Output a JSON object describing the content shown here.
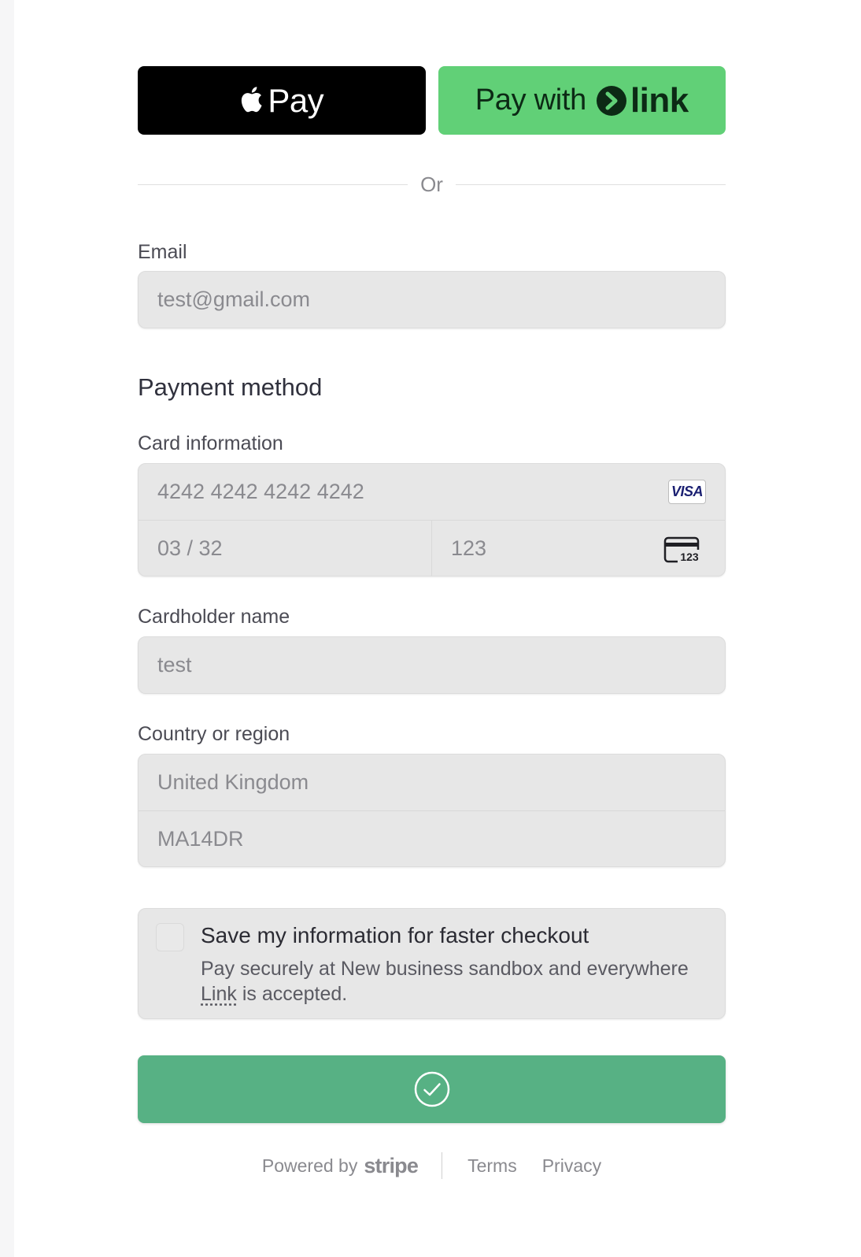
{
  "express": {
    "apple_pay_label": "Pay",
    "link_pay_prefix": "Pay with",
    "link_brand": "link"
  },
  "divider": {
    "text": "Or"
  },
  "email": {
    "label": "Email",
    "value": "test@gmail.com"
  },
  "payment_method": {
    "title": "Payment method",
    "card_info_label": "Card information",
    "card_number": "4242 4242 4242 4242",
    "card_brand": "VISA",
    "expiry": "03 / 32",
    "cvc": "123",
    "cvc_icon_text": "123"
  },
  "cardholder": {
    "label": "Cardholder name",
    "value": "test"
  },
  "country": {
    "label": "Country or region",
    "value": "United Kingdom",
    "postal_code": "MA14DR"
  },
  "save_info": {
    "checked": false,
    "title": "Save my information for faster checkout",
    "desc_before": "Pay securely at New business sandbox and everywhere",
    "desc_link": "Link",
    "desc_after": "is accepted."
  },
  "submit": {
    "state": "success",
    "icon": "check-circle-icon"
  },
  "footer": {
    "powered_by": "Powered by",
    "brand": "stripe",
    "terms": "Terms",
    "privacy": "Privacy"
  },
  "colors": {
    "link_green": "#61d077",
    "submit_green": "#57b184",
    "field_bg": "#e7e7e7"
  }
}
